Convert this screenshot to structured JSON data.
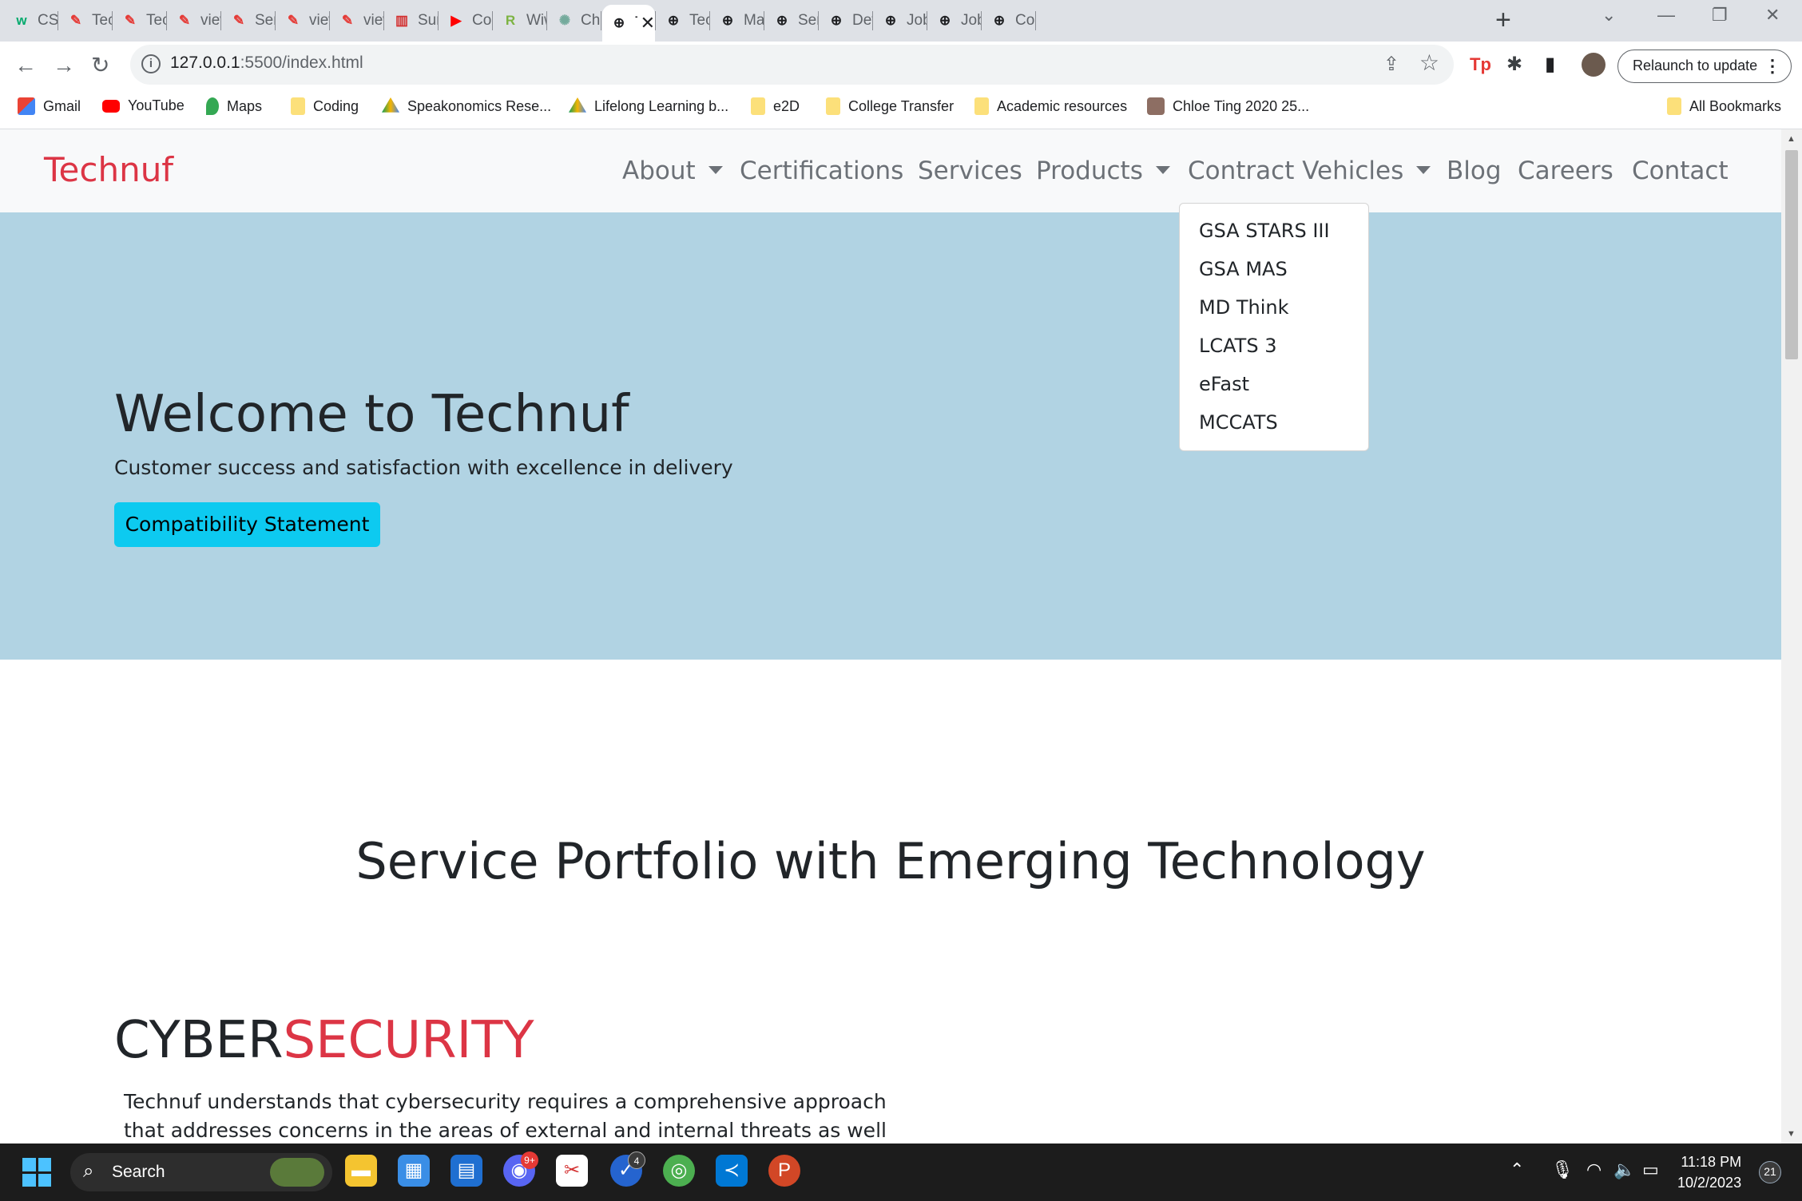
{
  "browser": {
    "tabs": [
      {
        "label": "CSS",
        "icon": "w3schools-icon",
        "color": "#04aa6d"
      },
      {
        "label": "Tech",
        "icon": "pen-icon",
        "color": "#e53935"
      },
      {
        "label": "Tech",
        "icon": "pen-icon",
        "color": "#e53935"
      },
      {
        "label": "view",
        "icon": "pen-icon",
        "color": "#e53935"
      },
      {
        "label": "Serv",
        "icon": "pen-icon",
        "color": "#e53935"
      },
      {
        "label": "view",
        "icon": "pen-icon",
        "color": "#e53935"
      },
      {
        "label": "view",
        "icon": "pen-icon",
        "color": "#e53935"
      },
      {
        "label": "Sum",
        "icon": "book-icon",
        "color": "#d32f2f"
      },
      {
        "label": "Com",
        "icon": "youtube-icon",
        "color": "#ff0000"
      },
      {
        "label": "Wiw",
        "icon": "r-icon",
        "color": "#7cb342"
      },
      {
        "label": "Chat",
        "icon": "openai-icon",
        "color": "#74aa9c"
      },
      {
        "label": "T",
        "icon": "globe-icon",
        "color": "#202124",
        "active": true
      },
      {
        "label": "Tech",
        "icon": "globe-icon",
        "color": "#202124"
      },
      {
        "label": "Mair",
        "icon": "globe-icon",
        "color": "#202124"
      },
      {
        "label": "Serv",
        "icon": "globe-icon",
        "color": "#202124"
      },
      {
        "label": "Deve",
        "icon": "globe-icon",
        "color": "#202124"
      },
      {
        "label": "Jobs",
        "icon": "globe-icon",
        "color": "#202124"
      },
      {
        "label": "Jobs",
        "icon": "globe-icon",
        "color": "#202124"
      },
      {
        "label": "Cont",
        "icon": "globe-icon",
        "color": "#202124"
      }
    ],
    "url_host": "127.0.0.1",
    "url_path": ":5500/index.html",
    "relaunch_label": "Relaunch to update",
    "bookmarks": [
      {
        "label": "Gmail",
        "icon": "gmail-icon"
      },
      {
        "label": "YouTube",
        "icon": "youtube-icon"
      },
      {
        "label": "Maps",
        "icon": "maps-icon"
      },
      {
        "label": "Coding",
        "icon": "folder-icon"
      },
      {
        "label": "Speakonomics Rese...",
        "icon": "drive-icon"
      },
      {
        "label": "Lifelong Learning b...",
        "icon": "drive-icon"
      },
      {
        "label": "e2D",
        "icon": "folder-icon"
      },
      {
        "label": "College Transfer",
        "icon": "folder-icon"
      },
      {
        "label": "Academic resources",
        "icon": "folder-icon"
      },
      {
        "label": "Chloe Ting 2020 25...",
        "icon": "profile-icon"
      }
    ],
    "all_bookmarks_label": "All Bookmarks"
  },
  "site": {
    "brand": "Technuf",
    "brand_color": "#dc3545",
    "nav": {
      "about": "About",
      "certifications": "Certifications",
      "services": "Services",
      "products": "Products",
      "contract_vehicles": "Contract Vehicles",
      "blog": "Blog",
      "careers": "Careers",
      "contact": "Contact"
    },
    "contract_dropdown": [
      "GSA STARS III",
      "GSA MAS",
      "MD Think",
      "LCATS 3",
      "eFast",
      "MCCATS"
    ],
    "hero": {
      "title": "Welcome to Technuf",
      "subtitle": "Customer success and satisfaction with excellence in delivery",
      "button": "Compatibility Statement",
      "background": "#b1d3e3",
      "button_color": "#0dcaf0"
    },
    "portfolio_title": "Service Portfolio with Emerging Technology",
    "cyber": {
      "prefix": "CYBER",
      "accent": "SECURITY",
      "text": "Technuf understands that cybersecurity requires a comprehensive approach that addresses concerns in the areas of external and internal threats as well as"
    }
  },
  "taskbar": {
    "search_label": "Search",
    "discord_badge": "9+",
    "todo_badge": "4",
    "time": "11:18 PM",
    "date": "10/2/2023",
    "notifications": "21"
  }
}
